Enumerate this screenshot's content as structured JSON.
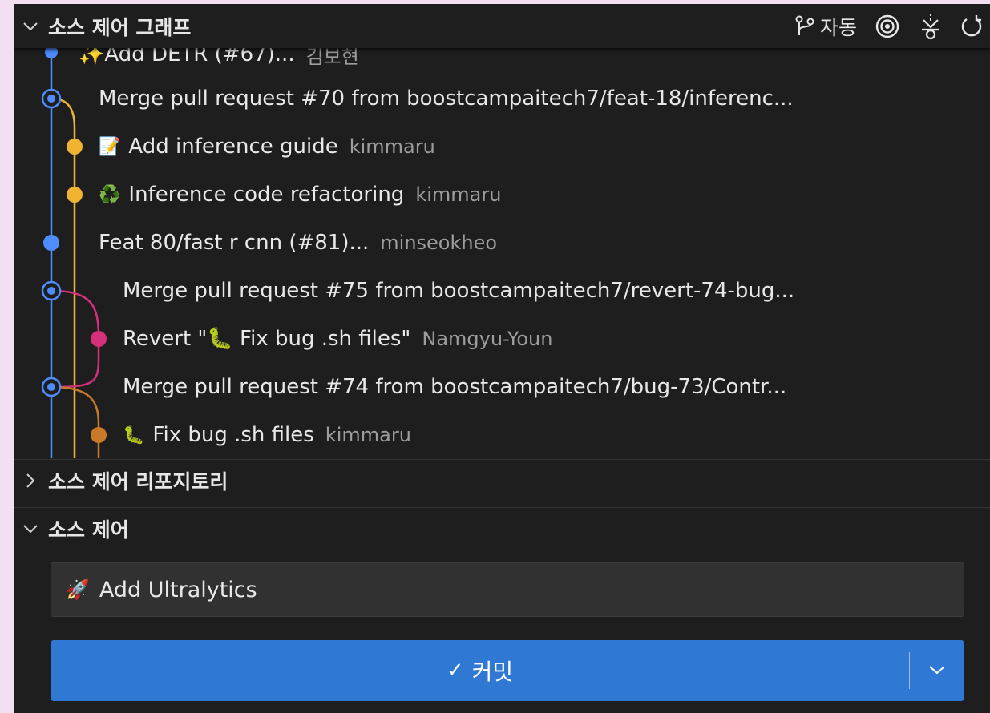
{
  "colors": {
    "panel_bg": "#1e1e1e",
    "input_bg": "#313131",
    "primary_button": "#2f78d4",
    "lane_blue": "#4f8dff",
    "lane_yellow": "#f0b432",
    "lane_pink": "#d6307a",
    "lane_brown": "#c87a28"
  },
  "graph_section": {
    "title": "소스 제어 그래프",
    "actions": {
      "branch_label": "자동",
      "branch_icon": "git-branch-icon",
      "target_icon": "target-icon",
      "fetch_icon": "fetch-icon",
      "refresh_icon": "refresh-icon"
    },
    "commits": [
      {
        "message": "✨Add DETR (#67)...",
        "author": "김보현",
        "lane": "blue",
        "type": "commit"
      },
      {
        "message": "Merge pull request #70 from boostcampaitech7/feat-18/inferenc...",
        "author": "",
        "lane": "blue",
        "type": "merge"
      },
      {
        "emoji": "📝",
        "message": "Add inference guide",
        "author": "kimmaru",
        "lane": "yellow",
        "type": "commit"
      },
      {
        "emoji": "♻️",
        "message": "Inference code refactoring",
        "author": "kimmaru",
        "lane": "yellow",
        "type": "commit"
      },
      {
        "message": "Feat 80/fast r cnn (#81)...",
        "author": "minseokheo",
        "lane": "blue",
        "type": "commit"
      },
      {
        "message": "Merge pull request #75 from boostcampaitech7/revert-74-bug...",
        "author": "",
        "lane": "blue",
        "type": "merge"
      },
      {
        "message": "Revert \"🐛 Fix bug .sh files\"",
        "author": "Namgyu-Youn",
        "lane": "pink",
        "type": "commit"
      },
      {
        "message": "Merge pull request #74 from boostcampaitech7/bug-73/Contr...",
        "author": "",
        "lane": "blue",
        "type": "merge"
      },
      {
        "emoji": "🐛",
        "message": "Fix bug .sh files",
        "author": "kimmaru",
        "lane": "brown",
        "type": "commit"
      }
    ]
  },
  "repositories_section": {
    "title": "소스 제어 리포지토리",
    "collapsed": true
  },
  "source_control_section": {
    "title": "소스 제어",
    "commit_message": "Add Ultralytics",
    "commit_message_emoji": "🚀",
    "commit_button": {
      "check": "✓",
      "label": "커밋"
    }
  }
}
